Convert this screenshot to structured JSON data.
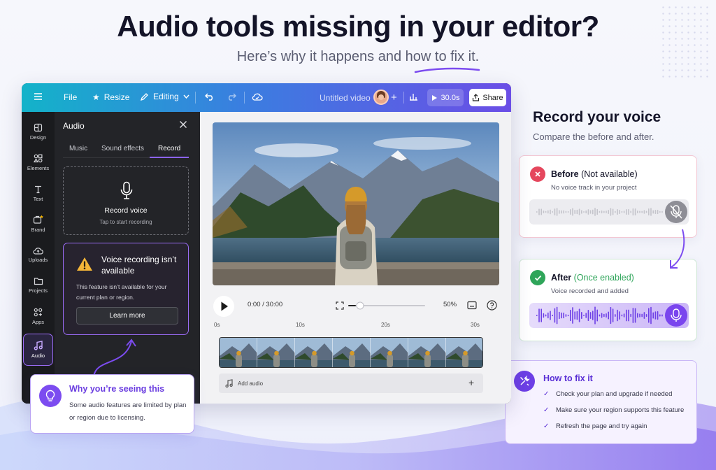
{
  "header": {
    "title": "Audio tools missing in your editor?",
    "subtitle": "Here’s why it happens and how to fix it."
  },
  "topbar": {
    "file": "File",
    "resize": "Resize",
    "editing": "Editing",
    "doc_title": "Untitled video",
    "duration": "30.0s",
    "share": "Share"
  },
  "rail": {
    "items": [
      {
        "label": "Design",
        "icon": "design-icon"
      },
      {
        "label": "Elements",
        "icon": "elements-icon"
      },
      {
        "label": "Text",
        "icon": "text-icon"
      },
      {
        "label": "Brand",
        "icon": "brand-icon"
      },
      {
        "label": "Uploads",
        "icon": "uploads-icon"
      },
      {
        "label": "Projects",
        "icon": "projects-icon"
      },
      {
        "label": "Apps",
        "icon": "apps-icon"
      },
      {
        "label": "Audio",
        "icon": "music-icon"
      }
    ],
    "active": "Audio"
  },
  "audio_panel": {
    "title": "Audio",
    "tabs": [
      "Music",
      "Sound effects",
      "Record"
    ],
    "active_tab": "Record",
    "record_label": "Record voice",
    "record_hint": "Tap to start recording",
    "warning_title": "Voice recording isn’t available",
    "warning_text": "This feature isn’t available for your current plan or region.",
    "learn_more": "Learn more"
  },
  "player": {
    "time": "0:00 / 30:00",
    "zoom": "50%",
    "progress": 0.1,
    "ruler": [
      "0s",
      "10s",
      "20s",
      "30s"
    ],
    "add_audio": "Add audio"
  },
  "why": {
    "title": "Why you’re seeing this",
    "text": "Some audio features are limited by plan or region due to licensing."
  },
  "record_section": {
    "title": "Record your voice",
    "subtitle": "Compare the before and after.",
    "before_title": "Before",
    "before_status": "(Not available)",
    "before_desc": "No voice track in your project",
    "after_title": "After",
    "after_status": "(Once enabled)",
    "after_desc": "Voice recorded and added"
  },
  "fix": {
    "title": "How to fix it",
    "steps": [
      "Check your plan and upgrade if needed",
      "Make sure your region supports this feature",
      "Refresh the page and try again"
    ]
  },
  "colors": {
    "accent": "#7c4cf0",
    "topbar_start": "#13b3c9",
    "topbar_end": "#6b4ee6",
    "error": "#e5475d",
    "success": "#2fa55a"
  }
}
